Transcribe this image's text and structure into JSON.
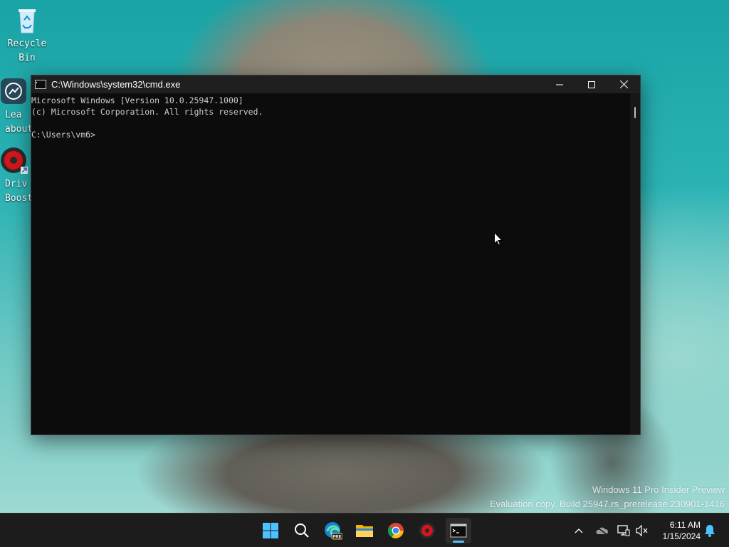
{
  "desktop": {
    "icons": [
      {
        "label_line1": "Recycle",
        "label_line2": "Bin",
        "icon": "recycle-bin-icon"
      },
      {
        "label_line1": "Lea",
        "label_line2": "about",
        "icon": "learn-about-icon"
      },
      {
        "label_line1": "Driv",
        "label_line2": "Boost",
        "icon": "driver-booster-icon"
      }
    ]
  },
  "cmd": {
    "title": "C:\\Windows\\system32\\cmd.exe",
    "lines": [
      "Microsoft Windows [Version 10.0.25947.1000]",
      "(c) Microsoft Corporation. All rights reserved.",
      "",
      "C:\\Users\\vm6>"
    ],
    "controls": {
      "minimize": "—",
      "maximize": "☐",
      "close": "✕"
    }
  },
  "watermark": {
    "line1": "Windows 11 Pro Insider Preview",
    "line2": "Evaluation copy. Build 25947.rs_prerelease.230901-1416"
  },
  "taskbar": {
    "apps": [
      {
        "name": "start",
        "icon": "windows-start-icon"
      },
      {
        "name": "search",
        "icon": "search-icon"
      },
      {
        "name": "edge-preview",
        "icon": "edge-pre-icon",
        "badge": "PRE"
      },
      {
        "name": "file-explorer",
        "icon": "folder-icon"
      },
      {
        "name": "chrome",
        "icon": "chrome-icon"
      },
      {
        "name": "driver-booster",
        "icon": "driver-booster-icon"
      },
      {
        "name": "command-prompt",
        "icon": "cmd-icon",
        "active": true
      }
    ],
    "tray": {
      "chevron": "^",
      "time": "6:11 AM",
      "date": "1/15/2024"
    }
  },
  "colors": {
    "taskbar_bg": "#1c1c1c",
    "accent": "#4cc2ff",
    "console_bg": "#0c0c0c"
  }
}
